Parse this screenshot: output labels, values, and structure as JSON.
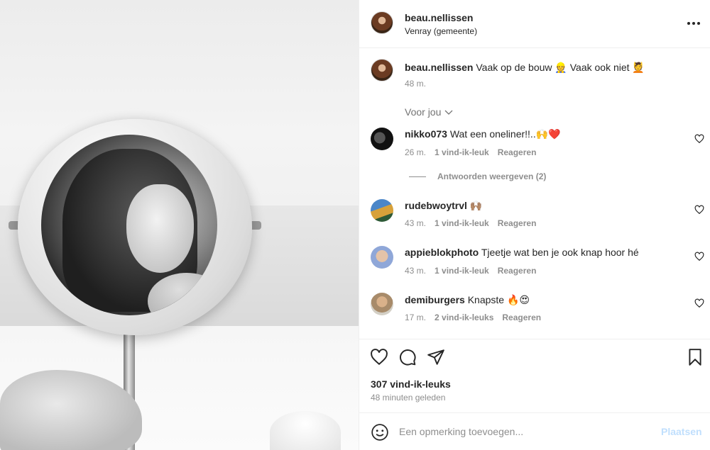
{
  "post": {
    "author": "beau.nellissen",
    "location": "Venray (gemeente)",
    "caption_text": "Vaak op de bouw 👷 Vaak ook niet 💆",
    "caption_time": "48 m."
  },
  "filter_label": "Voor jou",
  "comments": [
    {
      "user": "nikko073",
      "text": "Wat een oneliner!!..🙌❤️",
      "time": "26 m.",
      "likes": "1 vind-ik-leuk",
      "reply": "Reageren"
    },
    {
      "user": "rudebwoytrvl",
      "text": "🙌🏽",
      "time": "43 m.",
      "likes": "1 vind-ik-leuk",
      "reply": "Reageren"
    },
    {
      "user": "appieblokphoto",
      "text": "Tjeetje wat ben je ook knap hoor hé",
      "time": "43 m.",
      "likes": "1 vind-ik-leuk",
      "reply": "Reageren"
    },
    {
      "user": "demiburgers",
      "text": "Knapste 🔥😍",
      "time": "17 m.",
      "likes": "2 vind-ik-leuks",
      "reply": "Reageren"
    }
  ],
  "view_replies": "Antwoorden weergeven (2)",
  "like_count": "307 vind-ik-leuks",
  "posted_ago": "48 minuten geleden",
  "comment_box": {
    "placeholder": "Een opmerking toevoegen...",
    "post_label": "Plaatsen"
  },
  "icons": [
    "more-icon",
    "chevron-down-icon",
    "heart-icon",
    "comment-icon",
    "share-icon",
    "bookmark-icon",
    "emoji-icon"
  ],
  "colors": {
    "post_button_disabled": "#c0dffd",
    "secondary_text": "#8e8e8e"
  }
}
